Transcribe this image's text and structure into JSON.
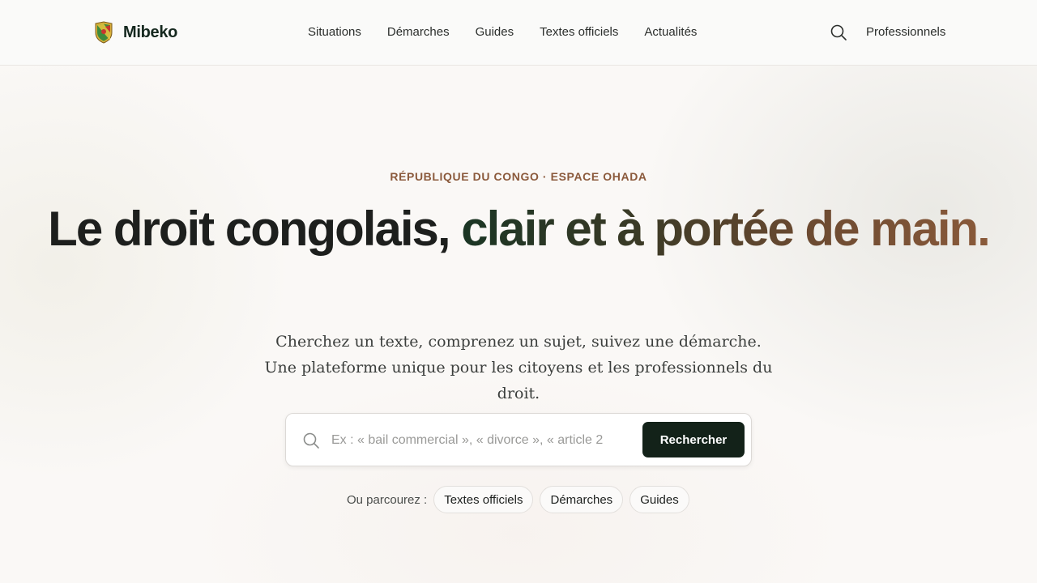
{
  "header": {
    "brand": "Mibeko",
    "nav": [
      "Situations",
      "Démarches",
      "Guides",
      "Textes officiels",
      "Actualités"
    ],
    "pro_link": "Professionnels",
    "search_icon": "search-icon",
    "logo_icon": "coat-of-arms-icon"
  },
  "hero": {
    "eyebrow": "RÉPUBLIQUE DU CONGO · ESPACE OHADA",
    "title_plain": "Le droit congolais, ",
    "title_accent": "clair et à portée de main.",
    "lead": "Cherchez un texte, comprenez un sujet, suivez une démarche. Une plateforme unique pour les citoyens et les professionnels du droit."
  },
  "search": {
    "placeholder": "Ex : « bail commercial », « divorce », « article 2",
    "value": "",
    "button": "Rechercher"
  },
  "browse": {
    "label": "Ou parcourez :",
    "chips": [
      "Textes officiels",
      "Démarches",
      "Guides"
    ]
  },
  "colors": {
    "accent_dark": "#132219",
    "accent_brown": "#8b5a3c",
    "background": "#faf8f6"
  }
}
